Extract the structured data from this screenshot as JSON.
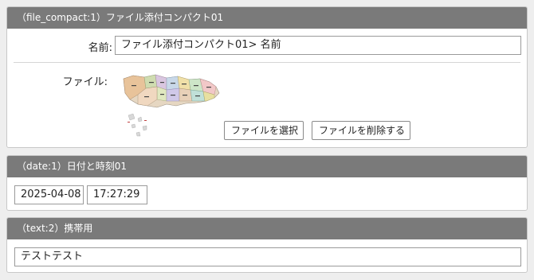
{
  "file_panel": {
    "header": "（file_compact:1）ファイル添付コンパクト01",
    "name_label": "名前:",
    "name_value": "ファイル添付コンパクト01> 名前",
    "file_label": "ファイル:",
    "select_button": "ファイルを選択",
    "delete_button": "ファイルを削除する"
  },
  "date_panel": {
    "header": "（date:1）日付と時刻01",
    "date_value": "2025-04-08",
    "time_value": "17:27:29"
  },
  "text_panel": {
    "header": "（text:2）携帯用",
    "text_value": "テストテスト"
  }
}
